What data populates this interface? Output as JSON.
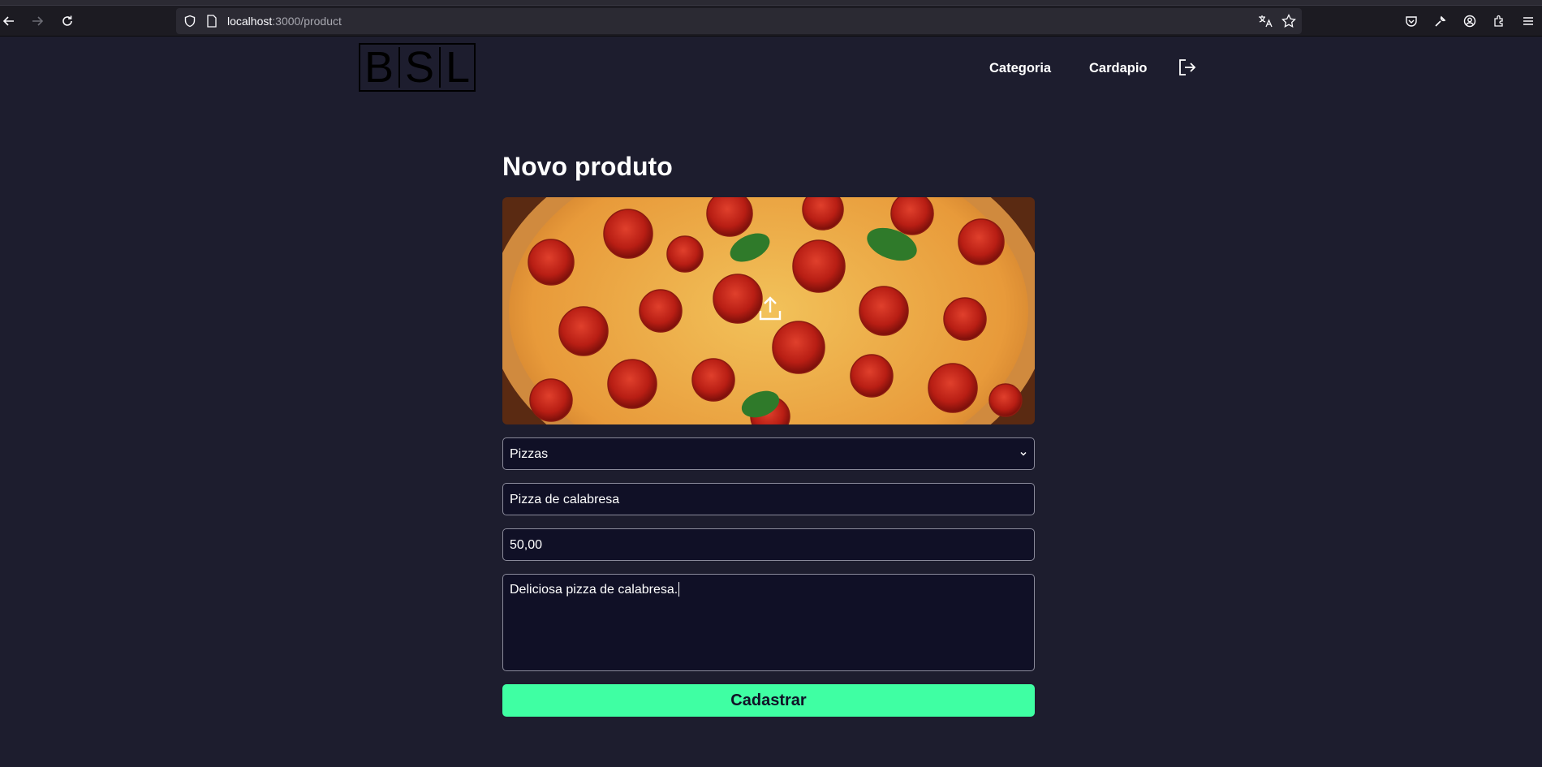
{
  "browser": {
    "url_host": "localhost",
    "url_path": ":3000/product"
  },
  "header": {
    "logo_letters": [
      "B",
      "S",
      "L"
    ],
    "nav": [
      "Categoria",
      "Cardapio"
    ]
  },
  "form": {
    "title": "Novo produto",
    "category_select": {
      "selected": "Pizzas"
    },
    "name_input": {
      "value": "Pizza de calabresa"
    },
    "price_input": {
      "value": "50,00"
    },
    "description_textarea": {
      "value": "Deliciosa pizza de calabresa."
    },
    "submit_label": "Cadastrar"
  },
  "colors": {
    "page_background": "#1d1d2e",
    "field_background": "#101026",
    "submit_background": "#3fffa3"
  }
}
